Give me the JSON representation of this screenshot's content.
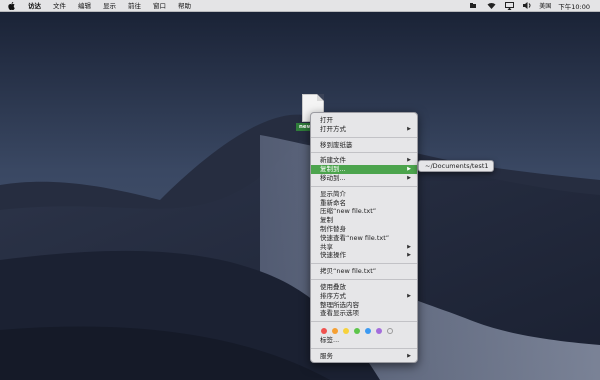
{
  "menubar": {
    "app_name": "访达",
    "items": [
      "文件",
      "编辑",
      "显示",
      "前往",
      "窗口",
      "帮助"
    ],
    "status": {
      "icons": [
        "dropbox-icon",
        "wifi-icon",
        "airplay-icon",
        "volume-icon"
      ],
      "input_source": "美国",
      "clock": "下午10:00"
    }
  },
  "desktop": {
    "file_label": "new"
  },
  "context_menu": {
    "sections": [
      [
        {
          "label": "打开",
          "submenu": false
        },
        {
          "label": "打开方式",
          "submenu": true
        }
      ],
      [
        {
          "label": "移到废纸篓",
          "submenu": false
        }
      ],
      [
        {
          "label": "新建文件",
          "submenu": true
        },
        {
          "label": "复制到...",
          "submenu": true,
          "highlighted": true
        },
        {
          "label": "移动到...",
          "submenu": true
        }
      ],
      [
        {
          "label": "显示简介",
          "submenu": false
        },
        {
          "label": "重新命名",
          "submenu": false
        },
        {
          "label": "压缩“new file.txt”",
          "submenu": false
        },
        {
          "label": "复制",
          "submenu": false
        },
        {
          "label": "制作替身",
          "submenu": false
        },
        {
          "label": "快速查看“new file.txt”",
          "submenu": false
        },
        {
          "label": "共享",
          "submenu": true
        },
        {
          "label": "快速操作",
          "submenu": true
        }
      ],
      [
        {
          "label": "拷贝“new file.txt”",
          "submenu": false
        }
      ],
      [
        {
          "label": "使用叠放",
          "submenu": false
        },
        {
          "label": "排序方式",
          "submenu": true
        },
        {
          "label": "整理所选内容",
          "submenu": false
        },
        {
          "label": "查看显示选项",
          "submenu": false
        }
      ]
    ],
    "tag_colors": [
      "#f0524f",
      "#f5a033",
      "#f7d23c",
      "#5dc54a",
      "#3c9af2",
      "#a46ddc",
      "empty"
    ],
    "tags_label": "标签...",
    "services": {
      "label": "服务",
      "submenu": true
    }
  },
  "submenu": {
    "item": "~/Documents/test1"
  }
}
